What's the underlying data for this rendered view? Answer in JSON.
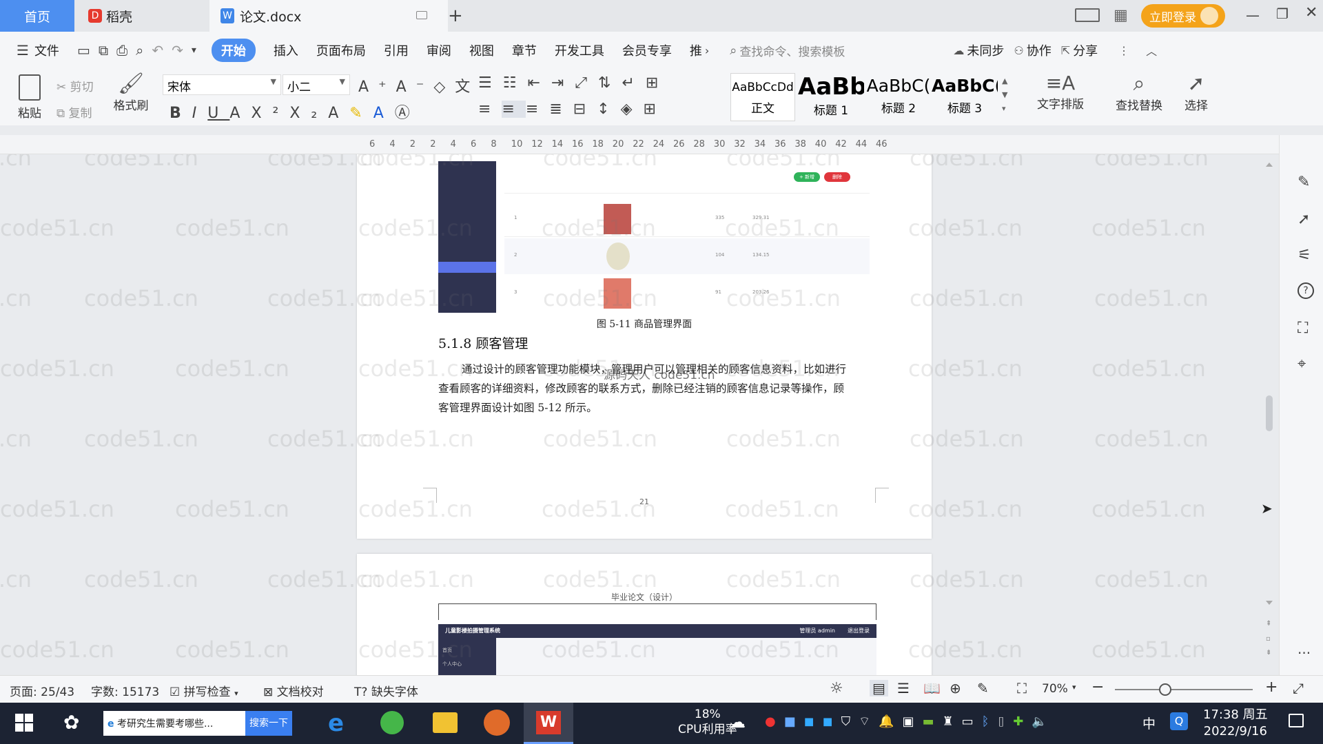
{
  "tabs": {
    "home": "首页",
    "daoke": "稻壳",
    "doc": "论文.docx",
    "login": "立即登录"
  },
  "menu": {
    "file": "文件",
    "start": "开始",
    "insert": "插入",
    "layout": "页面布局",
    "ref": "引用",
    "review": "审阅",
    "view": "视图",
    "chapter": "章节",
    "dev": "开发工具",
    "vip": "会员专享",
    "more": "推",
    "search": "查找命令、搜索模板",
    "sync": "未同步",
    "collab": "协作",
    "share": "分享"
  },
  "ribbon": {
    "paste": "粘贴",
    "cut": "剪切",
    "copy": "复制",
    "format_painter": "格式刷",
    "font": "宋体",
    "size": "小二",
    "style_normal": "正文",
    "style_h1": "标题 1",
    "style_h2": "标题 2",
    "style_h3": "标题 3",
    "style_preview_normal": "AaBbCcDd",
    "style_preview_h1": "AaBb",
    "style_preview_h2": "AaBbC(",
    "style_preview_h3": "AaBbC(",
    "text_layout": "文字排版",
    "find_replace": "查找替换",
    "select": "选择"
  },
  "ruler": [
    "6",
    "4",
    "2",
    "2",
    "4",
    "6",
    "8",
    "10",
    "12",
    "14",
    "16",
    "18",
    "20",
    "22",
    "24",
    "26",
    "28",
    "30",
    "32",
    "34",
    "36",
    "38",
    "40",
    "42",
    "44",
    "46"
  ],
  "document": {
    "figure_caption": "图 5-11 商品管理界面",
    "heading": "5.1.8 顾客管理",
    "para_lines": [
      "通过设计的顾客管理功能模块，管理用户可以管理相关的顾客信息资料，比如进行",
      "查看顾客的详细资料，修改顾客的联系方式，删除已经注销的顾客信息记录等操作，顾",
      "客管理界面设计如图 5-12 所示。"
    ],
    "overlay_text": "源码天人 code51.cn",
    "page_number": "21",
    "header_next": "毕业论文（设计）",
    "app_title": "儿童影楼拍摄管理系统",
    "app_user": "管理员 admin",
    "app_logout": "退出登录",
    "app_home": "首页",
    "app_personal": "个人中心",
    "app_add": "+ 新增",
    "app_delete": "删除",
    "app_rows": [
      {
        "idx": "1",
        "price": "329.31",
        "qty": "335"
      },
      {
        "idx": "2",
        "price": "134.15",
        "qty": "104"
      },
      {
        "idx": "3",
        "price": "203.26",
        "qty": "91"
      }
    ]
  },
  "watermark": "code51.cn",
  "status": {
    "page": "页面: 25/43",
    "words": "字数: 15173",
    "spell": "拼写检查",
    "proof": "文档校对",
    "missing_font": "缺失字体",
    "zoom": "70%"
  },
  "taskbar": {
    "search_text": "考研究生需要考哪些...",
    "search_btn": "搜索一下",
    "cpu": "18%",
    "cpu_label": "CPU利用率",
    "time": "17:38 周五",
    "date": "2022/9/16",
    "ime": "中"
  },
  "colors": {
    "accent": "#4d8ff0",
    "login": "#f4a31a",
    "sidebar": "#2f3350",
    "taskbar": "#1c2333"
  }
}
